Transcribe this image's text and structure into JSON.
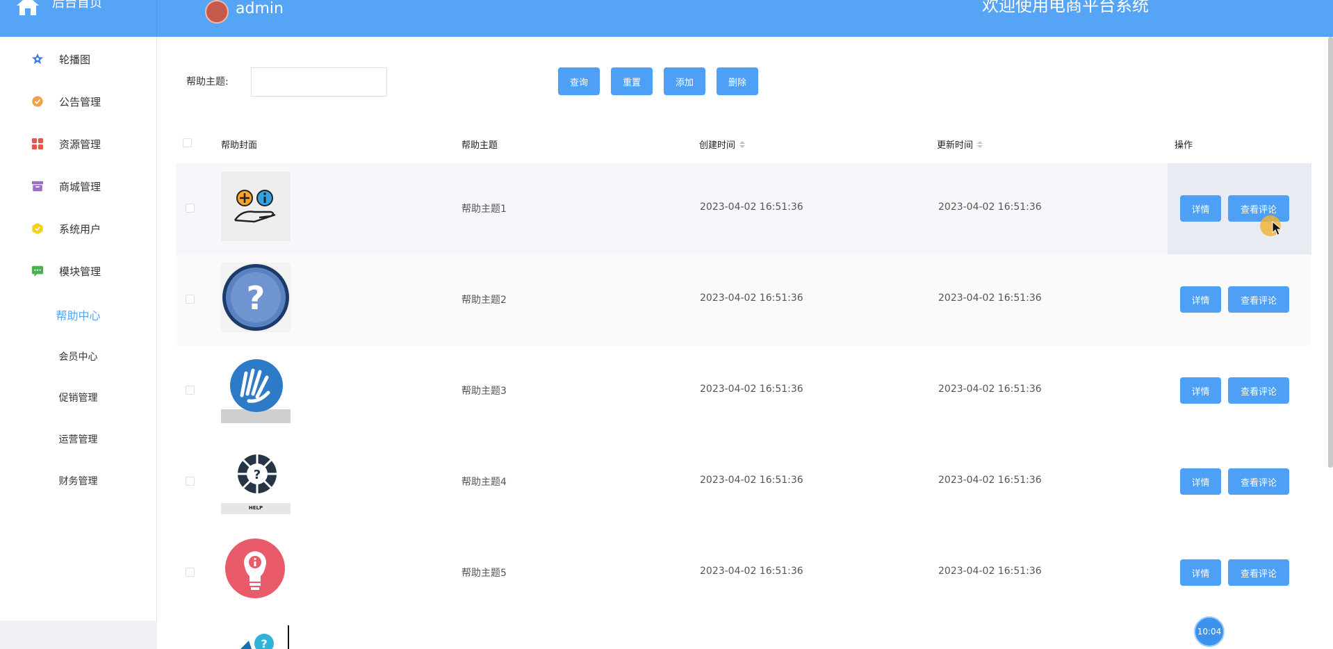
{
  "header": {
    "brand_label": "后台首页",
    "username": "admin",
    "welcome": "欢迎使用电商平台系统"
  },
  "sidebar": {
    "items": [
      {
        "label": "轮播图",
        "icon": "star-icon",
        "color": "#3b7de0"
      },
      {
        "label": "公告管理",
        "icon": "badge-icon",
        "color": "#f0a24b"
      },
      {
        "label": "资源管理",
        "icon": "grid-icon",
        "color": "#e8554a"
      },
      {
        "label": "商城管理",
        "icon": "archive-icon",
        "color": "#9c6fc5"
      },
      {
        "label": "系统用户",
        "icon": "cube-icon",
        "color": "#f2d21a"
      },
      {
        "label": "模块管理",
        "icon": "chat-icon",
        "color": "#4caf50"
      }
    ],
    "subitems": [
      {
        "label": "帮助中心",
        "active": true
      },
      {
        "label": "会员中心",
        "active": false
      },
      {
        "label": "促销管理",
        "active": false
      },
      {
        "label": "运营管理",
        "active": false
      },
      {
        "label": "财务管理",
        "active": false
      }
    ]
  },
  "search": {
    "label": "帮助主题:",
    "value": "",
    "query_label": "查询",
    "reset_label": "重置",
    "add_label": "添加",
    "delete_label": "删除"
  },
  "table": {
    "columns": [
      "帮助封面",
      "帮助主题",
      "创建时间",
      "更新时间",
      "操作"
    ],
    "rows": [
      {
        "title": "帮助主题1",
        "created": "2023-04-02 16:51:36",
        "updated": "2023-04-02 16:51:36",
        "cover": "plus-info-hand-icon"
      },
      {
        "title": "帮助主题2",
        "created": "2023-04-02 16:51:36",
        "updated": "2023-04-02 16:51:36",
        "cover": "question-circle-icon"
      },
      {
        "title": "帮助主题3",
        "created": "2023-04-02 16:51:36",
        "updated": "2023-04-02 16:51:36",
        "cover": "sign-hands-icon"
      },
      {
        "title": "帮助主题4",
        "created": "2023-04-02 16:51:36",
        "updated": "2023-04-02 16:51:36",
        "cover": "help-wheel-icon",
        "cover_text": "HELP"
      },
      {
        "title": "帮助主题5",
        "created": "2023-04-02 16:51:36",
        "updated": "2023-04-02 16:51:36",
        "cover": "lightbulb-info-icon"
      }
    ],
    "detail_label": "详情",
    "comments_label": "查看评论"
  },
  "clock": "10:04",
  "colors": {
    "primary": "#56a4f5",
    "button": "#4da0f5"
  }
}
